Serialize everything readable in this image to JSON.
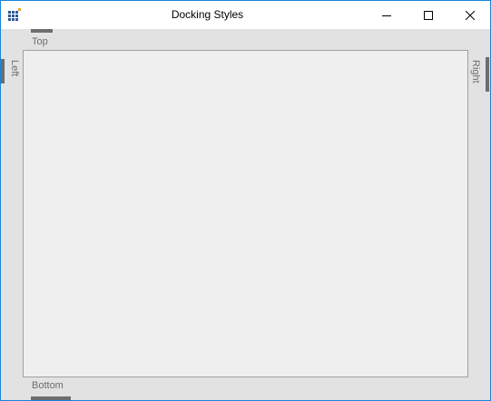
{
  "window": {
    "title": "Docking Styles"
  },
  "titlebar": {
    "app_icon": "grid-app-icon",
    "buttons": [
      "minimize-icon",
      "maximize-icon",
      "close-icon"
    ]
  },
  "tabs": {
    "top": "Top",
    "bottom": "Bottom",
    "left": "Left",
    "right": "Right"
  },
  "colors": {
    "accent": "#1883d7",
    "tab": "#6d6d6d",
    "panel": "#efefef",
    "background": "#e2e2e2"
  }
}
